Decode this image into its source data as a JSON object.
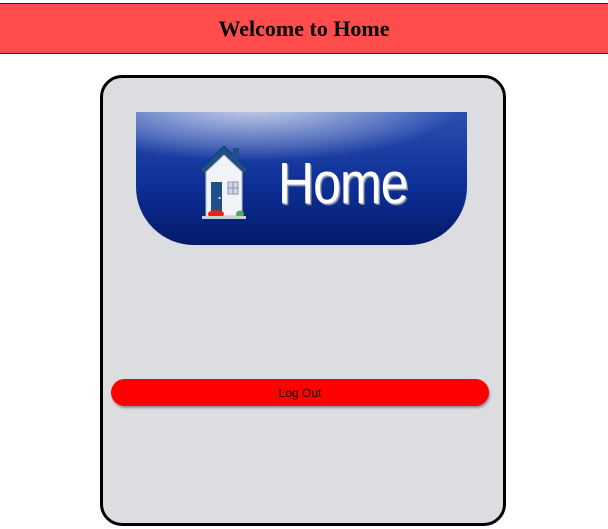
{
  "header": {
    "title": "Welcome to Home"
  },
  "banner": {
    "text": "Home",
    "icon": "house-icon"
  },
  "actions": {
    "logout_label": "Log Out"
  },
  "colors": {
    "header_bg": "#ff4d4d",
    "card_bg": "#dcdde0",
    "banner_blue": "#0d2f96",
    "logout_bg": "#ff0000"
  }
}
